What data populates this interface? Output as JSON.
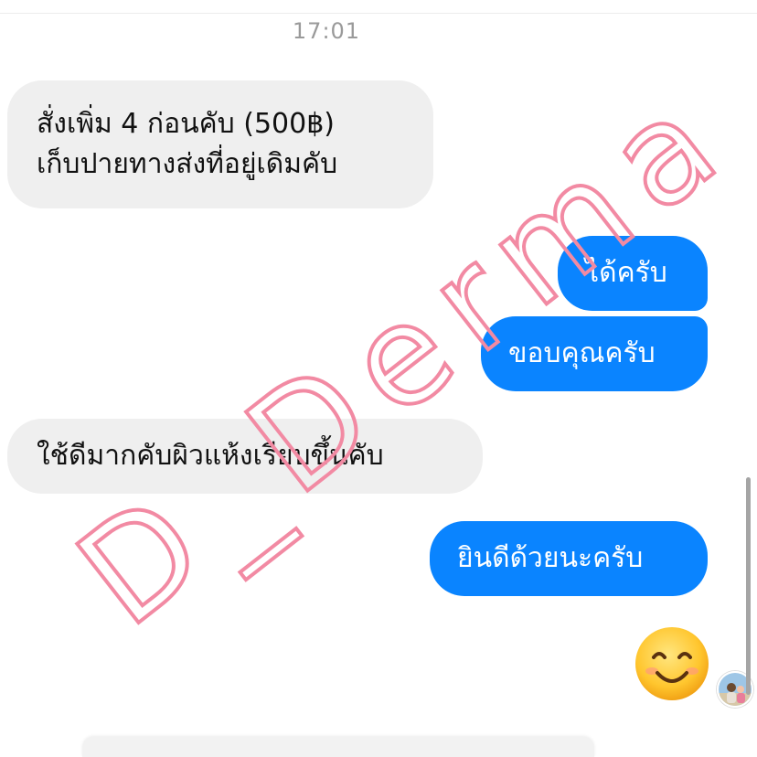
{
  "chat": {
    "timestamp": "17:01",
    "messages": [
      {
        "side": "incoming",
        "line1": "สั่งเพิ่ม 4 ก่อนคับ (500฿)",
        "line2": "เก็บปายทางส่งที่อยู่เดิมคับ"
      },
      {
        "side": "outgoing",
        "text": "ได้ครับ"
      },
      {
        "side": "outgoing",
        "text": "ขอบคุณครับ"
      },
      {
        "side": "incoming",
        "text": "ใช้ดีมากคับผิวแห้งเรียบขึ้นคับ"
      },
      {
        "side": "outgoing",
        "text": "ยินดีด้วยนะครับ"
      }
    ],
    "reaction_emoji": "smiling-face-with-smiling-eyes"
  },
  "watermark": {
    "text": "D_Derma",
    "color": "#f28aa3"
  },
  "colors": {
    "outgoing_bubble": "#0a84ff",
    "incoming_bubble": "#efefef"
  }
}
